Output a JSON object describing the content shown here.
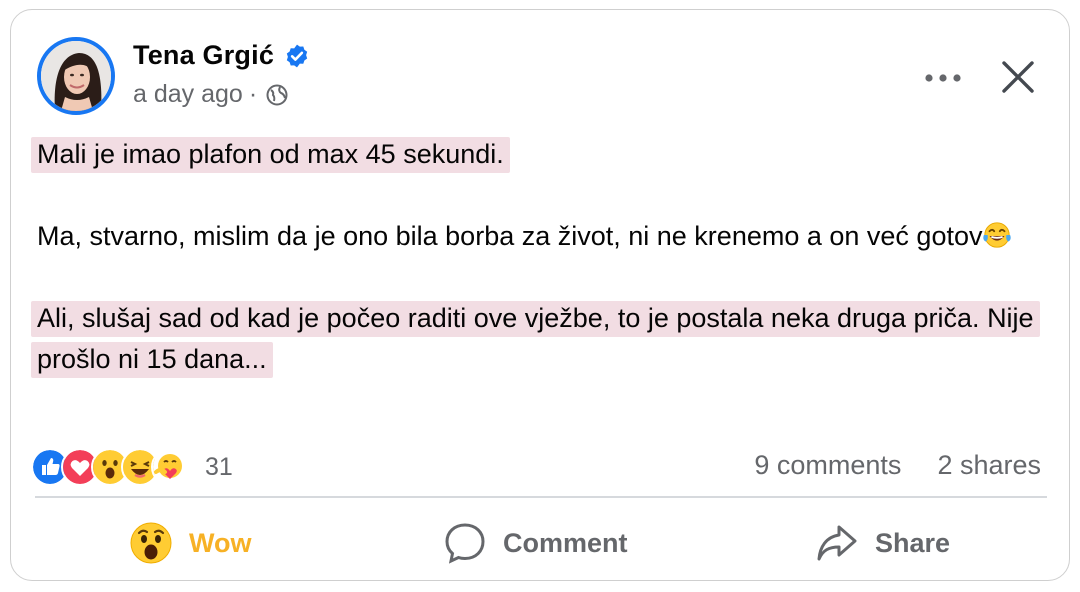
{
  "post": {
    "author": "Tena Grgić",
    "time": "a day ago",
    "separator": "·",
    "icons": {
      "verified": "verified-badge-icon",
      "audience": "globe-icon",
      "more": "more-horizontal-icon",
      "close": "close-icon"
    },
    "paragraphs": [
      {
        "text": "Mali je imao plafon od max 45 sekundi.",
        "highlighted": true
      },
      {
        "text": "Ma, stvarno, mislim da je ono bila borba za život, ni ne krenemo a on već gotov",
        "highlighted": false,
        "trailing_emoji": "tears-of-joy-emoji"
      },
      {
        "text": "Ali, slušaj sad od kad je počeo raditi ove vježbe, to je postala neka druga priča. Nije prošlo ni 15 dana...",
        "highlighted": true
      }
    ]
  },
  "reactions": {
    "icons": [
      "like",
      "love",
      "wow",
      "haha",
      "care"
    ],
    "count": "31"
  },
  "stats": {
    "comments": "9 comments",
    "shares": "2 shares"
  },
  "actions": {
    "wow": "Wow",
    "comment": "Comment",
    "share": "Share"
  },
  "colors": {
    "verified_blue": "#1877f2",
    "highlight": "#f2dde3",
    "wow_active": "#f7b125",
    "secondary_text": "#65676b"
  }
}
